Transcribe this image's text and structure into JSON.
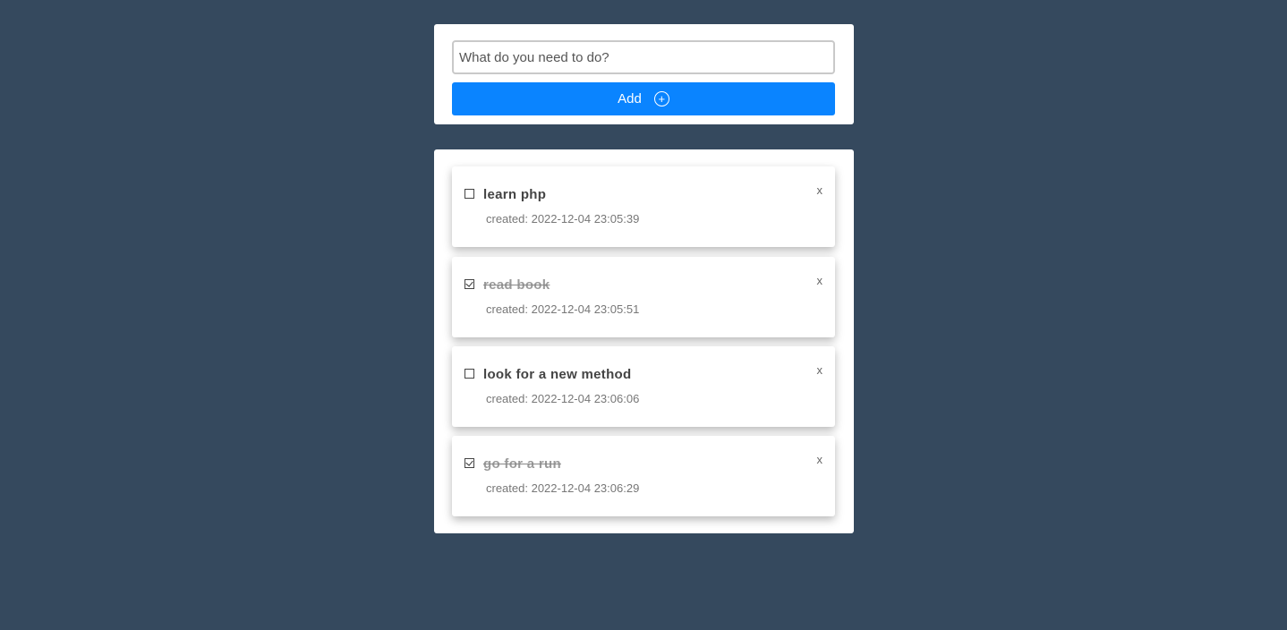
{
  "form": {
    "input_placeholder": "What do you need to do?",
    "input_value": "",
    "add_label": "Add",
    "add_icon": "plus-circle-icon",
    "button_color": "#0a84ff"
  },
  "todos": [
    {
      "title": "learn php",
      "created_label": "created: 2022-12-04 23:05:39",
      "done": false,
      "delete_label": "x"
    },
    {
      "title": "read book",
      "created_label": "created: 2022-12-04 23:05:51",
      "done": true,
      "delete_label": "x"
    },
    {
      "title": "look for a new method",
      "created_label": "created: 2022-12-04 23:06:06",
      "done": false,
      "delete_label": "x"
    },
    {
      "title": "go for a run",
      "created_label": "created: 2022-12-04 23:06:29",
      "done": true,
      "delete_label": "x"
    }
  ],
  "colors": {
    "background": "#35495e",
    "card": "#ffffff"
  }
}
